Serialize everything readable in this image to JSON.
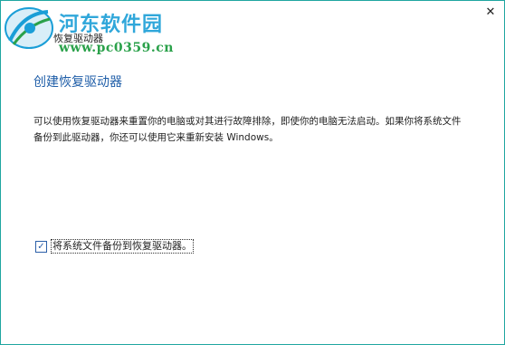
{
  "watermark": {
    "title": "河东软件园",
    "url": "www.pc0359.cn"
  },
  "window": {
    "title": "恢复驱动器",
    "close_label": "✕"
  },
  "main": {
    "heading": "创建恢复驱动器",
    "description": "可以使用恢复驱动器来重置你的电脑或对其进行故障排除，即使你的电脑无法启动。如果你将系统文件备份到此驱动器，你还可以使用它来重新安装 Windows。",
    "checkbox": {
      "label": "将系统文件备份到恢复驱动器。",
      "checked": true,
      "check_glyph": "✓"
    }
  },
  "colors": {
    "heading": "#1f5ea8",
    "watermark_title": "#1a9ed7",
    "watermark_url": "#2aa14a",
    "window_border": "#1fa6a1"
  }
}
